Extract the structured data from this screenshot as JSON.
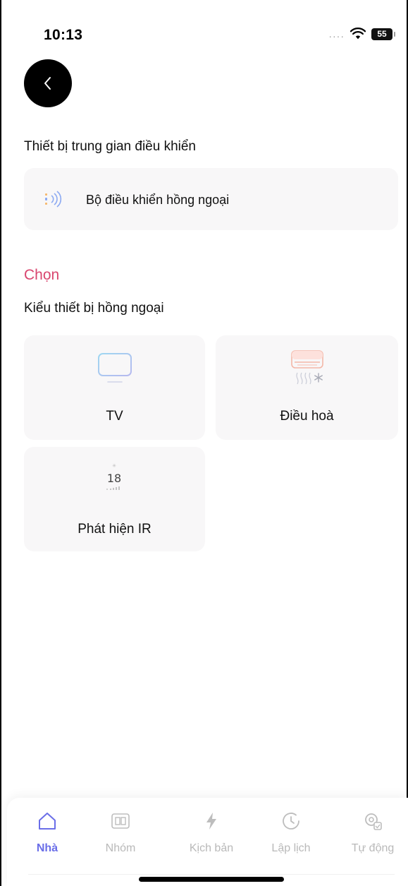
{
  "status_bar": {
    "time": "10:13",
    "battery": "55"
  },
  "header": {
    "back_icon": "chevron-left-icon"
  },
  "hub_section": {
    "title": "Thiết bị trung gian điều khiển",
    "hub_label": "Bộ điều khiển hồng ngoại",
    "hub_icon": "ir-signal-icon"
  },
  "device_section": {
    "select_label": "Chọn",
    "title": "Kiểu thiết bị hồng ngoại",
    "tiles": [
      {
        "label": "TV",
        "icon": "tv-icon"
      },
      {
        "label": "Điều hoà",
        "icon": "air-conditioner-icon"
      },
      {
        "label": "Phát hiện IR",
        "icon": "ir-sensor-icon",
        "value_text": "18"
      }
    ]
  },
  "bottom_nav": {
    "items": [
      {
        "label": "Nhà",
        "icon": "home-icon",
        "active": true
      },
      {
        "label": "Nhóm",
        "icon": "group-icon",
        "active": false
      },
      {
        "label": "Kịch bản",
        "icon": "lightning-icon",
        "active": false
      },
      {
        "label": "Lập lịch",
        "icon": "clock-icon",
        "active": false
      },
      {
        "label": "Tự động",
        "icon": "automation-gear-icon",
        "active": false
      }
    ]
  },
  "colors": {
    "accent": "#6a6ee8",
    "select_label": "#d9466f",
    "card_bg": "#f8f7f8",
    "inactive_nav": "#b9b9b9"
  }
}
